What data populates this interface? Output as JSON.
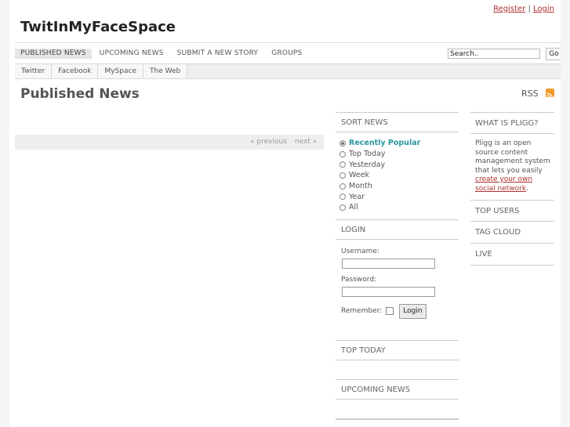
{
  "header": {
    "site_title": "TwitInMyFaceSpace",
    "register_label": "Register",
    "separator": "|",
    "login_label": "Login"
  },
  "nav": {
    "items": [
      "PUBLISHED NEWS",
      "UPCOMING NEWS",
      "SUBMIT A NEW STORY",
      "GROUPS"
    ],
    "active_index": 0
  },
  "search": {
    "value": "Search..",
    "go_label": "Go"
  },
  "subnav": {
    "items": [
      "Twitter",
      "Facebook",
      "MySpace",
      "The Web"
    ]
  },
  "main": {
    "title": "Published News",
    "rss_label": "RSS",
    "pager": {
      "previous_label": "« previous",
      "next_label": "next »"
    }
  },
  "sort": {
    "heading": "SORT NEWS",
    "options": [
      "Recently Popular",
      "Top Today",
      "Yesterday",
      "Week",
      "Month",
      "Year",
      "All"
    ],
    "selected_index": 0
  },
  "login": {
    "heading": "LOGIN",
    "username_label": "Username:",
    "password_label": "Password:",
    "remember_label": "Remember:",
    "button_label": "Login"
  },
  "blocks": {
    "top_today": "TOP TODAY",
    "upcoming_news": "UPCOMING NEWS"
  },
  "about": {
    "heading": "WHAT IS PLIGG?",
    "text": "Pligg is an open source content management system that lets you easily ",
    "link_text": "create your own social network",
    "text_end": "."
  },
  "right_links": [
    "TOP USERS",
    "TAG CLOUD",
    "LIVE"
  ],
  "colors": {
    "link": "#b03030",
    "selected_sort": "#2a95a0",
    "rss": "#f39c2a"
  }
}
